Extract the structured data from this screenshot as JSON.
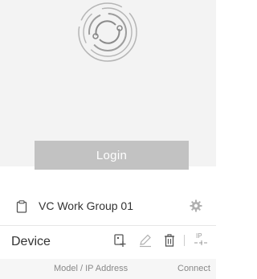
{
  "login": {
    "button_label": "Login"
  },
  "group": {
    "name": "VC Work Group 01"
  },
  "device": {
    "title": "Device",
    "ip_icon_text": "IP"
  },
  "columns": {
    "model": "Model / IP Address",
    "connect": "Connect"
  },
  "icons": {
    "logo": "sync-circle-logo",
    "group": "clipboard-icon",
    "settings": "gear-icon",
    "add": "add-device-icon",
    "edit": "pencil-icon",
    "delete": "trash-icon",
    "ip": "ip-address-icon"
  },
  "colors": {
    "header_bg": "#f3f3f3",
    "login_disabled": "#c2c2c2",
    "icon_gray": "#9a9a9a"
  }
}
